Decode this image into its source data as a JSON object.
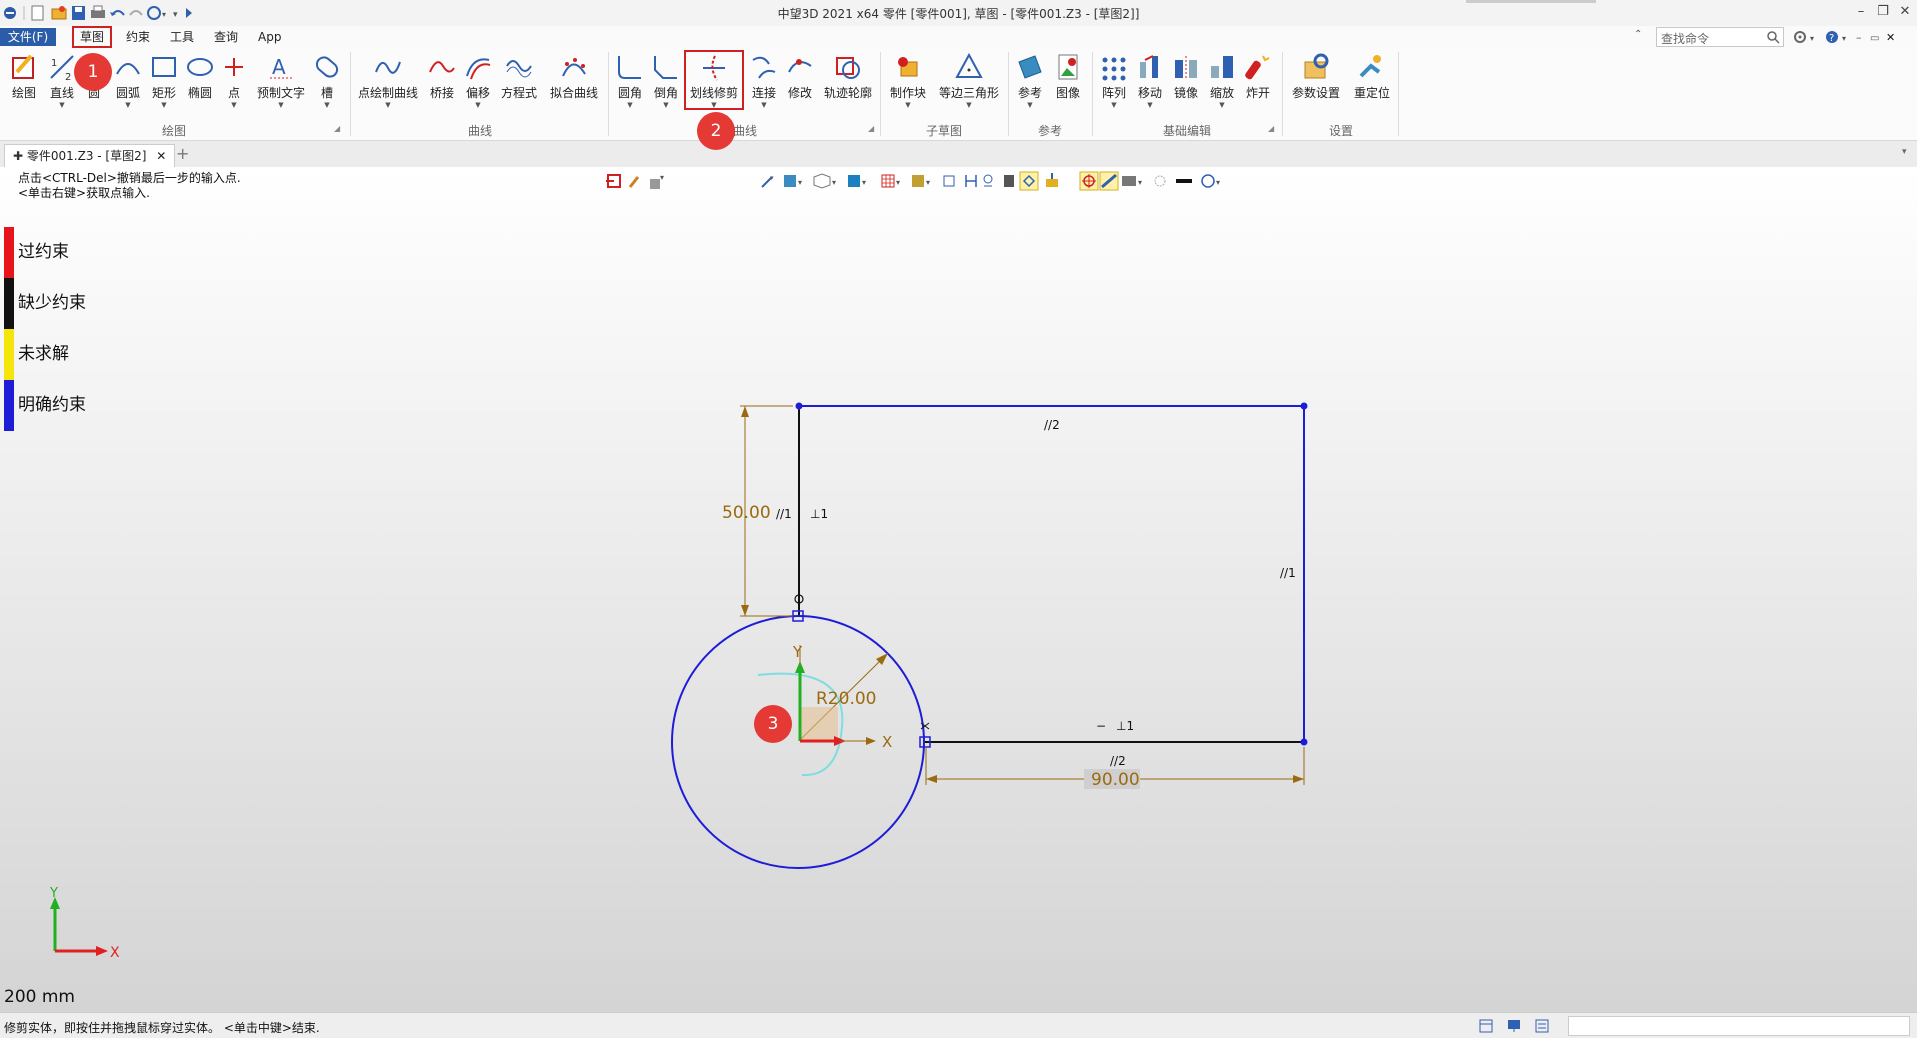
{
  "window": {
    "title": "中望3D 2021 x64          零件 [零件001], 草图 - [零件001.Z3 - [草图2]]",
    "search_placeholder": "查找命令"
  },
  "menu": {
    "file": "文件(F)",
    "sketch": "草图",
    "constraint": "约束",
    "tools": "工具",
    "query": "查询",
    "app": "App"
  },
  "ribbon": {
    "draw_group": {
      "label": "绘图",
      "items": [
        "绘图",
        "直线",
        "圆",
        "圆弧",
        "矩形",
        "椭圆",
        "点",
        "预制文字",
        "槽"
      ]
    },
    "curve_group": {
      "label": "曲线",
      "items": [
        "点绘制曲线",
        "桥接",
        "偏移",
        "方程式",
        "拟合曲线"
      ]
    },
    "edit_curve_group": {
      "label": "曲线",
      "items": [
        "圆角",
        "倒角",
        "划线修剪",
        "连接",
        "修改",
        "轨迹轮廓"
      ]
    },
    "subsketch_group": {
      "label": "子草图",
      "items": [
        "制作块",
        "等边三角形"
      ]
    },
    "reference_group": {
      "label": "参考",
      "items": [
        "参考",
        "图像"
      ]
    },
    "basic_edit_group": {
      "label": "基础编辑",
      "items": [
        "阵列",
        "移动",
        "镜像",
        "缩放",
        "炸开"
      ]
    },
    "settings_group": {
      "label": "设置",
      "items": [
        "参数设置",
        "重定位"
      ]
    }
  },
  "tabs": {
    "doc_tab": "零件001.Z3 - [草图2]",
    "close": "✕",
    "add": "+"
  },
  "hint": {
    "line1": "点击<CTRL-Del>撤销最后一步的输入点.",
    "line2": "<单击右键>获取点输入."
  },
  "legend": {
    "items": [
      {
        "label": "过约束",
        "color": "#e8141b"
      },
      {
        "label": "缺少约束",
        "color": "#111111"
      },
      {
        "label": "未求解",
        "color": "#f5e50a"
      },
      {
        "label": "明确约束",
        "color": "#1d1dd8"
      }
    ]
  },
  "sketch": {
    "dim_height": "50.00",
    "dim_width": "90.00",
    "dim_radius": "R20.00",
    "constraint_parallel_1": "//1",
    "constraint_parallel_2": "//2",
    "constraint_perp_1": "⊥1",
    "axis_x": "X",
    "axis_y": "Y"
  },
  "badges": {
    "b1": "1",
    "b2": "2",
    "b3": "3"
  },
  "triad": {
    "x": "X",
    "y": "Y"
  },
  "scale_label": "200 mm",
  "status": {
    "text": "修剪实体，即按住并拖拽鼠标穿过实体。 <单击中键>结束."
  },
  "colors": {
    "accent": "#2b5ca8",
    "highlight": "#d02020",
    "sketch_blue": "#1d1dd8",
    "dim_color": "#9b6a10",
    "badge": "#e53935"
  }
}
